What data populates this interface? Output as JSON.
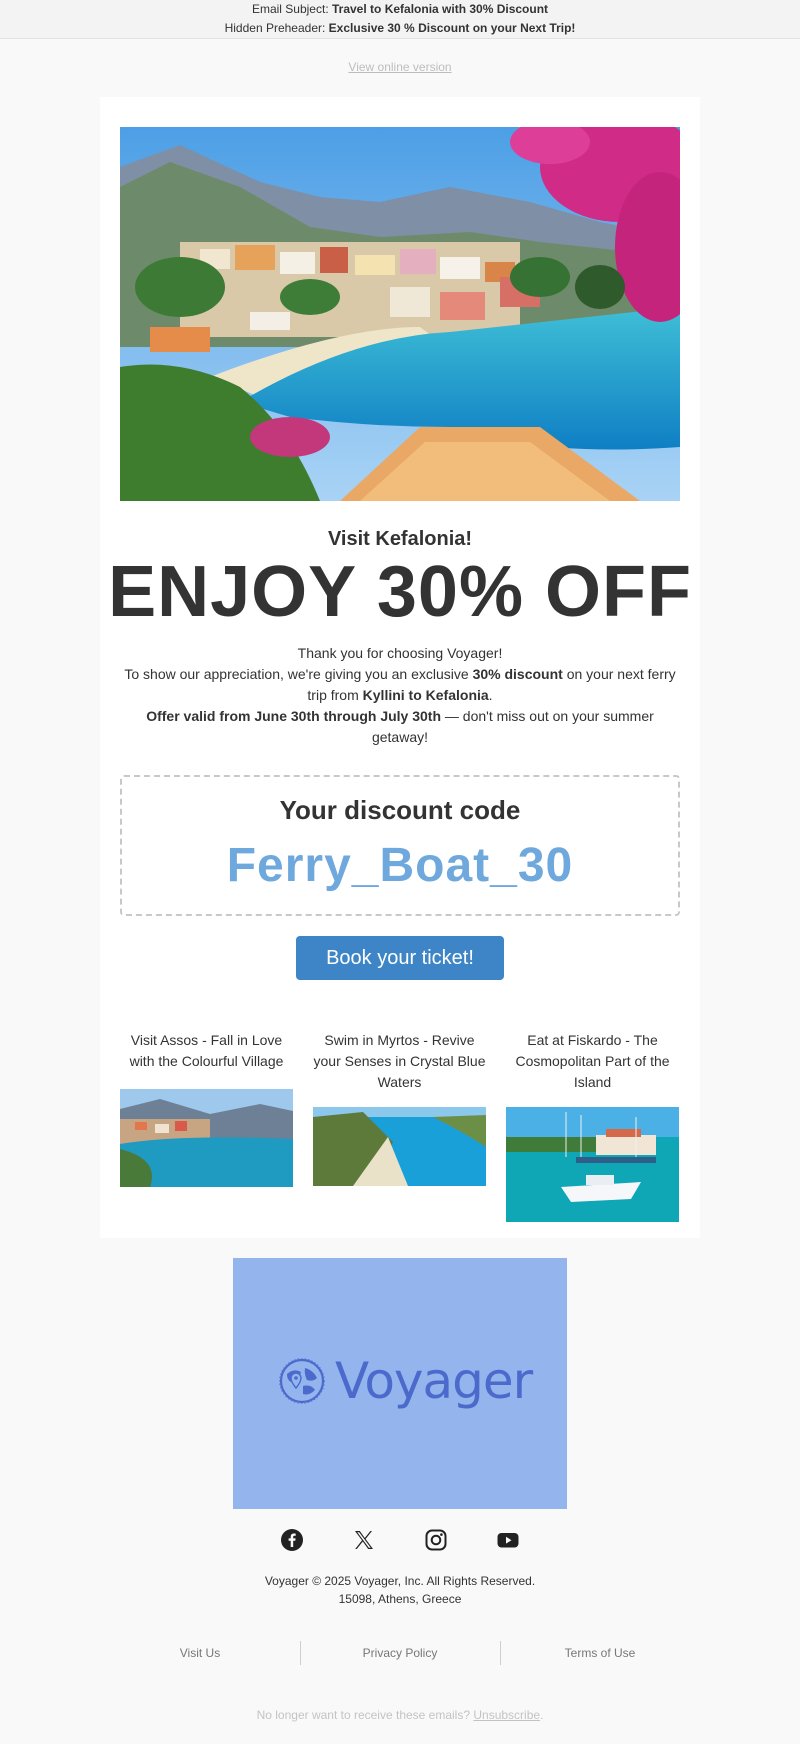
{
  "email_meta": {
    "subject_label": "Email Subject:",
    "subject": "Travel to Kefalonia with 30% Discount",
    "preheader_label": "Hidden Preheader:",
    "preheader": "Exclusive 30 % Discount on your Next Trip!"
  },
  "view_online": "View online version",
  "hero": {
    "title": "Visit Kefalonia!",
    "headline": "ENJOY 30% OFF"
  },
  "intro": {
    "line1": "Thank you for choosing Voyager!",
    "line2_a": "To show our appreciation, we're giving you an exclusive ",
    "line2_b": "30% discount",
    "line2_c": " on your next ferry trip from ",
    "line2_d": "Kyllini to Kefalonia",
    "line2_e": ".",
    "line3_a": "Offer valid from June 30th through July 30th",
    "line3_b": " — don't miss out on your summer getaway!"
  },
  "discount": {
    "heading": "Your discount code",
    "code": "Ferry_Boat_30"
  },
  "cta": {
    "label": "Book your ticket!"
  },
  "features": [
    {
      "title": "Visit Assos - Fall in Love with the Colourful Village"
    },
    {
      "title": "Swim in Myrtos - Revive your Senses in Crystal Blue Waters"
    },
    {
      "title": "Eat at Fiskardo - The Cosmopolitan Part of the Island"
    }
  ],
  "footer": {
    "brand": "Voyager",
    "social": [
      "facebook-icon",
      "x-icon",
      "instagram-icon",
      "youtube-icon"
    ],
    "copyright": "Voyager © 2025 Voyager, Inc. All Rights Reserved.",
    "address": "15098, Athens, Greece",
    "links": [
      "Visit Us",
      "Privacy Policy",
      "Terms of Use"
    ],
    "unsubscribe_text": "No longer want to receive these emails? ",
    "unsubscribe_link": "Unsubscribe",
    "unsubscribe_end": "."
  },
  "colors": {
    "accent": "#3d85c6",
    "code": "#6fa8dc",
    "logo_bg": "#93b4ec",
    "logo_fg": "#4b6acc"
  }
}
